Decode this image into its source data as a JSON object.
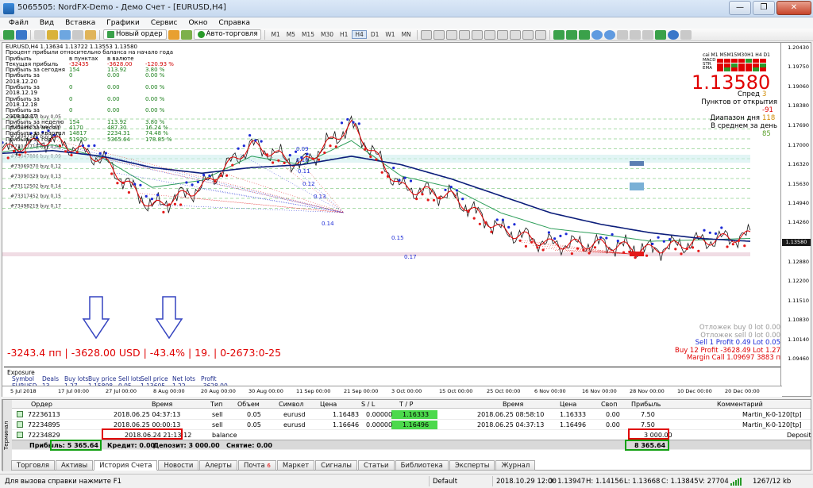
{
  "window": {
    "title": "5065505: NordFX-Demo - Демо Счет - [EURUSD,H4]",
    "controls": [
      "—",
      "❐",
      "✕"
    ]
  },
  "menu": [
    "Файл",
    "Вид",
    "Вставка",
    "Графики",
    "Сервис",
    "Окно",
    "Справка"
  ],
  "toolbar": {
    "new_order": "Новый ордер",
    "auto_trading": "Авто-торговля",
    "timeframes": [
      "M1",
      "M5",
      "M15",
      "M30",
      "H1",
      "H4",
      "D1",
      "W1",
      "MN"
    ],
    "active_timeframe": "H4"
  },
  "chart": {
    "symbol_header": "EURUSD,H4 1.13634 1.13722 1.13553 1.13580",
    "subtitle": "Процент прибыли относительно баланса на начало года",
    "info_headers": [
      "Прибыль",
      "в пунктах",
      "в валюте",
      ""
    ],
    "info_rows": [
      [
        "Текущая прибыль",
        "-32435",
        "-3628.00",
        "-120.93 %"
      ],
      [
        "Прибыль за сегодня",
        "154",
        "113.92",
        "3.80 %"
      ],
      [
        "Прибыль за 2018.12.20",
        "0",
        "0.00",
        "0.00 %"
      ],
      [
        "Прибыль за 2018.12.19",
        "0",
        "0.00",
        "0.00 %"
      ],
      [
        "Прибыль за 2018.12.18",
        "0",
        "0.00",
        "0.00 %"
      ],
      [
        "Прибыль за 2018.12.17",
        "0",
        "0.00",
        "0.00 %"
      ],
      [
        "Прибыль за неделю",
        "154",
        "113.92",
        "3.80 %"
      ],
      [
        "Прибыль за месяц",
        "4170",
        "487.30",
        "16.24 %"
      ],
      [
        "Прибыль за квартал",
        "14817",
        "2234.31",
        "74.48 %"
      ],
      [
        "Прибыль за год",
        "51920",
        "5365.64",
        "178.85 %"
      ]
    ],
    "big_price": "1.13580",
    "indicator_header": "cai M1 M5M15M30H1 H4 D1",
    "indicator_labels": [
      "MACD",
      "STR",
      "EMA"
    ],
    "stats": [
      {
        "label": "Спред",
        "value": "3"
      },
      {
        "label": "Пунктов от открытия",
        "value": "-91"
      },
      {
        "label": "Диапазон дня",
        "value": "118"
      },
      {
        "label": "В среднем за день",
        "value": "85"
      }
    ],
    "pending_buy": "Отложек buy 0    lot 0.00",
    "pending_sell": "Отложек sell 0    lot 0.00",
    "sell_line": "Sell 1  Profit 0.49  Lot 0.05",
    "buy_line": "Buy 12  Profit -3628.49  Lot 1.27",
    "margin_line": "Margin Call 1.09697   3883 п",
    "red_summary": "-3243.4 пп | -3628.00 USD | -43.4% | 19. | 0-2673:0-25",
    "exposure_title": "Exposure",
    "exposure_headers": [
      "Symbol",
      "Deals",
      "Buy lots",
      "Buy price",
      "Sell lots",
      "Sell price",
      "Net lots",
      "Profit"
    ],
    "exposure_values": [
      "EURUSD",
      "13",
      "1.27",
      "1.15808",
      "0.05",
      "1.13605",
      "1.22",
      "-3628.00"
    ],
    "order_labels": [
      "#73046873 buy 0.05",
      "#73046853 buy 0.06",
      "#73047167 buy 0.07",
      "#73047719 buy 0.08",
      "#73047886 buy 0.09",
      "#73069370 buy 0.12",
      "#73090329 buy 0.13",
      "#73112502 buy 0.14",
      "#73317452 buy 0.15",
      "#73498219 buy 0.17"
    ],
    "sell_step_labels": [
      "0.09",
      "0.10",
      "0.11",
      "0.12",
      "0.13",
      "0.14",
      "0.15",
      "0.17"
    ],
    "current_price_tag": "1.13580",
    "price_ticks": [
      "1.20430",
      "1.19750",
      "1.19060",
      "1.18380",
      "1.17690",
      "1.17000",
      "1.16320",
      "1.15630",
      "1.14940",
      "1.14260",
      "1.13580",
      "1.12880",
      "1.12200",
      "1.11510",
      "1.10830",
      "1.10140",
      "1.09460"
    ],
    "time_ticks": [
      "5 Jul 2018",
      "17 Jul 00:00",
      "27 Jul 00:00",
      "8 Aug 00:00",
      "20 Aug 00:00",
      "30 Aug 00:00",
      "11 Sep 00:00",
      "21 Sep 00:00",
      "3 Oct 00:00",
      "15 Oct 00:00",
      "25 Oct 00:00",
      "6 Nov 00:00",
      "16 Nov 00:00",
      "28 Nov 00:00",
      "10 Dec 00:00",
      "20 Dec 00:00"
    ]
  },
  "chart_data": {
    "type": "line",
    "x": [
      "5 Jul 2018",
      "17 Jul",
      "27 Jul",
      "8 Aug",
      "20 Aug",
      "30 Aug",
      "11 Sep",
      "21 Sep",
      "3 Oct",
      "15 Oct",
      "25 Oct",
      "6 Nov",
      "16 Nov",
      "28 Nov",
      "10 Dec",
      "20 Dec"
    ],
    "series": [
      {
        "name": "",
        "values": [
          1.168,
          1.172,
          1.165,
          1.148,
          1.155,
          1.17,
          1.163,
          1.177,
          1.155,
          1.152,
          1.14,
          1.135,
          1.135,
          1.133,
          1.136,
          1.138
        ]
      },
      {
        "name": "",
        "values": [
          1.167,
          1.168,
          1.166,
          1.162,
          1.16,
          1.162,
          1.163,
          1.166,
          1.163,
          1.158,
          1.152,
          1.146,
          1.142,
          1.139,
          1.137,
          1.136
        ]
      }
    ],
    "ylim": [
      1.0946,
      1.2043
    ],
    "ylabel": "",
    "xlabel": "",
    "title": ""
  },
  "terminal": {
    "side_label": "Терминал",
    "headers": [
      "Ордер",
      "Время",
      "Тип",
      "Объем",
      "Символ",
      "Цена",
      "S / L",
      "T / P",
      "Время",
      "Цена",
      "Своп",
      "Прибыль",
      "Комментарий"
    ],
    "rows": [
      [
        "72236113",
        "2018.06.25 04:37:13",
        "sell",
        "0.05",
        "eurusd",
        "1.16483",
        "0.00000",
        "1.16333",
        "2018.06.25 08:58:10",
        "1.16333",
        "0.00",
        "7.50",
        "Martin_K-0-120[tp]"
      ],
      [
        "72234895",
        "2018.06.25 00:00:13",
        "sell",
        "0.05",
        "eurusd",
        "1.16646",
        "0.00000",
        "1.16496",
        "2018.06.25 04:37:13",
        "1.16496",
        "0.00",
        "7.50",
        "Martin_K-0-120[tp]"
      ],
      [
        "72234829",
        "2018.06.24 21:13:12",
        "balance",
        "",
        "",
        "",
        "",
        "",
        "",
        "",
        "",
        "3 000.00",
        "Deposit"
      ]
    ],
    "summary": {
      "profit": "Прибыль: 5 365.64",
      "credit": "Кредит: 0.00",
      "deposit": "Депозит: 3 000.00",
      "withdrawal": "Снятие: 0.00",
      "total": "8 365.64"
    }
  },
  "tabs": [
    {
      "label": "Торговля"
    },
    {
      "label": "Активы"
    },
    {
      "label": "История Счета",
      "active": true
    },
    {
      "label": "Новости"
    },
    {
      "label": "Алерты"
    },
    {
      "label": "Почта",
      "badge": "6"
    },
    {
      "label": "Маркет"
    },
    {
      "label": "Сигналы"
    },
    {
      "label": "Статьи"
    },
    {
      "label": "Библиотека"
    },
    {
      "label": "Эксперты"
    },
    {
      "label": "Журнал"
    }
  ],
  "status": {
    "help": "Для вызова справки нажмите F1",
    "profile": "Default",
    "datetime": "2018.10.29 12:00",
    "open": "O: 1.13947",
    "high": "H: 1.14156",
    "low": "L: 1.13668",
    "close": "C: 1.13845",
    "volume": "V: 27704",
    "traffic": "1267/12 kb"
  },
  "colors": {
    "price_line": "#1a1a1a",
    "ma_red": "#e00000",
    "ma_green": "#2e9e5a",
    "ma_navy": "#0b1d7a",
    "buy_marker": "#1d2bd6",
    "sell_marker": "#e31a1a"
  }
}
